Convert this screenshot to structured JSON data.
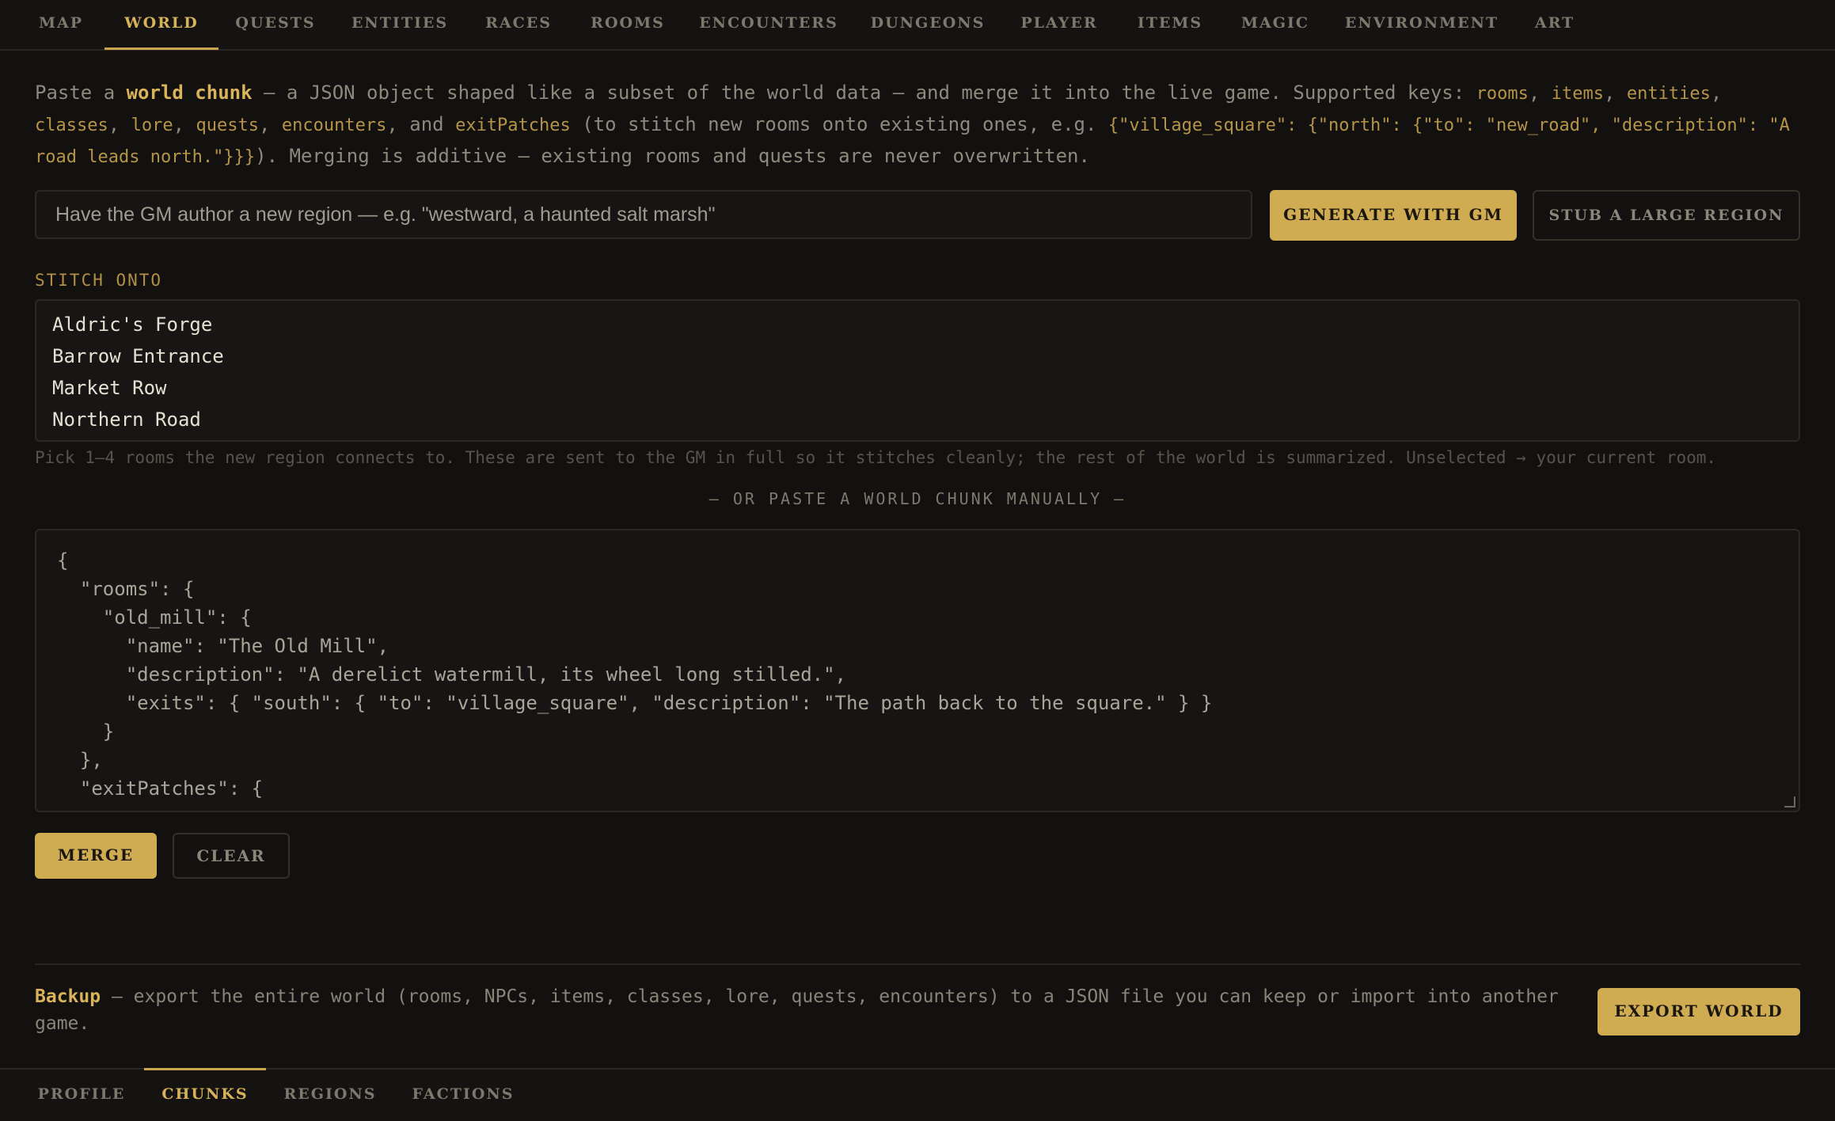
{
  "top_tabs": [
    "MAP",
    "WORLD",
    "QUESTS",
    "ENTITIES",
    "RACES",
    "ROOMS",
    "ENCOUNTERS",
    "DUNGEONS",
    "PLAYER",
    "ITEMS",
    "MAGIC",
    "ENVIRONMENT",
    "ART"
  ],
  "active_top_tab": "WORLD",
  "intro": {
    "t1": "Paste a ",
    "hl": "world chunk",
    "t2": " — a JSON object shaped like a subset of the world data — and merge it into the live game. Supported keys: ",
    "k_rooms": "rooms",
    "k_items": "items",
    "k_entities": "entities",
    "k_classes": "classes",
    "k_lore": "lore",
    "k_quests": "quests",
    "k_encounters": "encounters",
    "and": "and",
    "k_exitpatches": "exitPatches",
    "t3": " (to stitch new rooms onto existing ones, e.g. ",
    "example": "{\"village_square\": {\"north\": {\"to\": \"new_road\", \"description\": \"A road leads north.\"}}}",
    "t4": "). Merging is additive — existing rooms and quests are never overwritten."
  },
  "generate": {
    "placeholder": "Have the GM author a new region — e.g. \"westward, a haunted salt marsh\"",
    "generate_label": "GENERATE WITH GM",
    "stub_label": "STUB A LARGE REGION"
  },
  "stitch": {
    "label": "STITCH ONTO",
    "options": [
      "Aldric's Forge",
      "Barrow Entrance",
      "Market Row",
      "Northern Road"
    ],
    "hint": "Pick 1–4 rooms the new region connects to. These are sent to the GM in full so it stitches cleanly; the rest of the world is summarized. Unselected → your current room."
  },
  "manual": {
    "divider": "— OR PASTE A WORLD CHUNK MANUALLY —",
    "json_text": "{\n  \"rooms\": {\n    \"old_mill\": {\n      \"name\": \"The Old Mill\",\n      \"description\": \"A derelict watermill, its wheel long stilled.\",\n      \"exits\": { \"south\": { \"to\": \"village_square\", \"description\": \"The path back to the square.\" } }\n    }\n  },\n  \"exitPatches\": {",
    "merge_label": "MERGE",
    "clear_label": "CLEAR"
  },
  "backup": {
    "hl": "Backup",
    "text": " — export the entire world (rooms, NPCs, items, classes, lore, quests, encounters) to a JSON file you can keep or import into another game.",
    "export_label": "EXPORT WORLD"
  },
  "bottom_tabs": [
    "PROFILE",
    "CHUNKS",
    "REGIONS",
    "FACTIONS"
  ],
  "active_bottom_tab": "CHUNKS",
  "colors": {
    "accent": "#cfac52",
    "background": "#121110",
    "text": "#8f887c"
  }
}
